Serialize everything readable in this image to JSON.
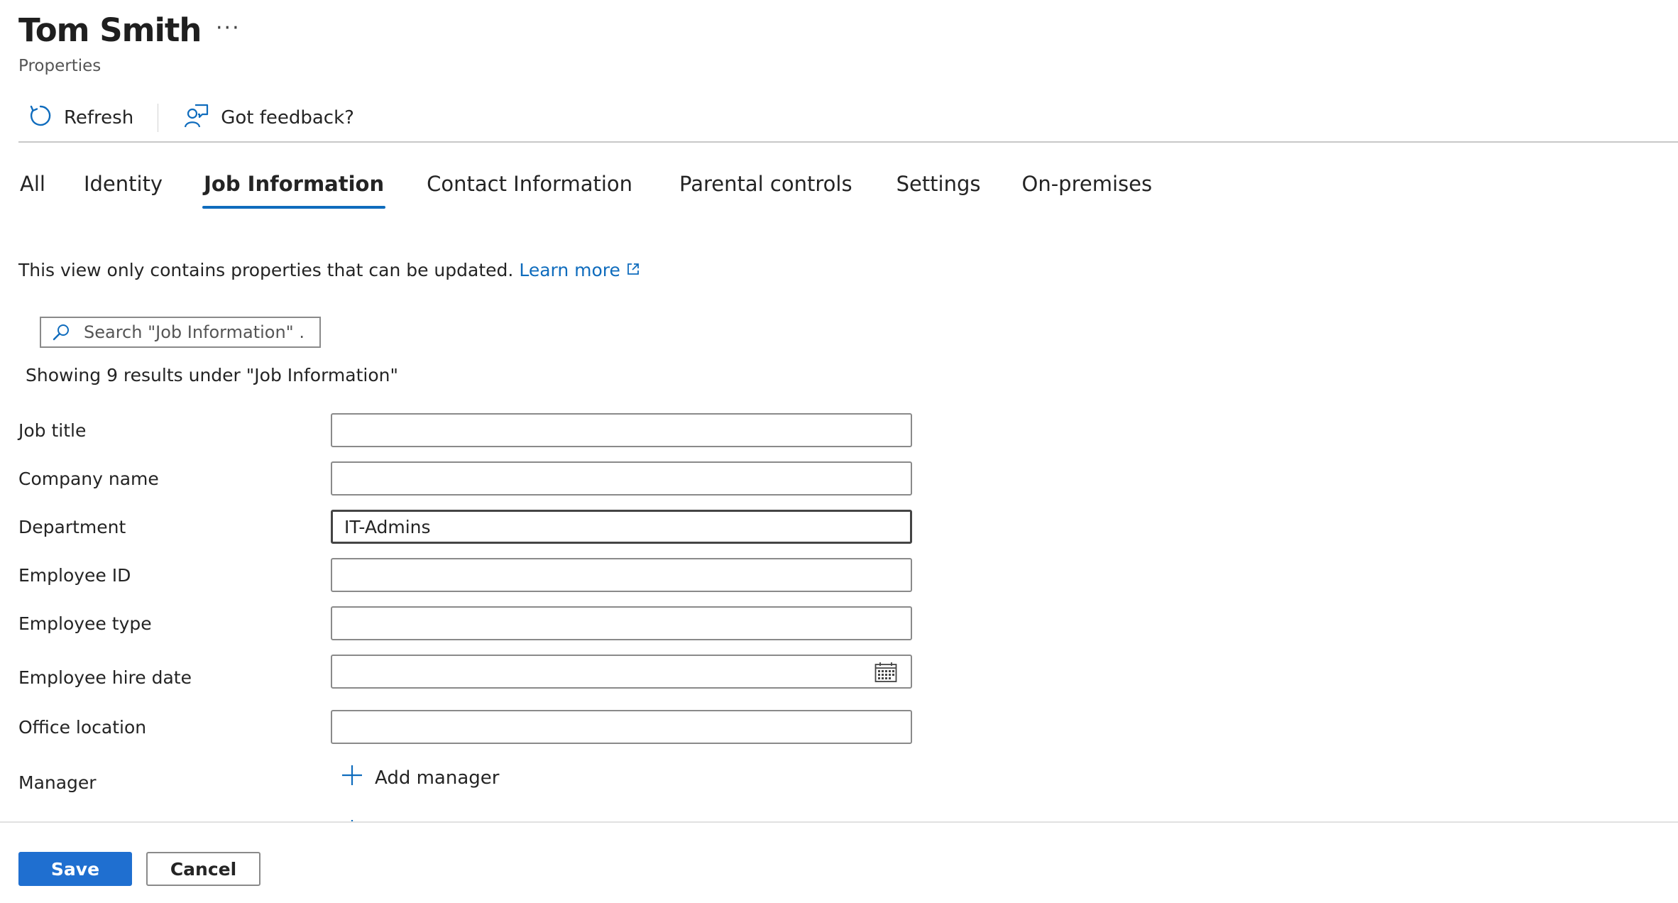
{
  "header": {
    "title": "Tom Smith",
    "more_label": "···",
    "subtitle": "Properties"
  },
  "toolbar": {
    "refresh_label": "Refresh",
    "feedback_label": "Got feedback?"
  },
  "tabs": [
    {
      "label": "All",
      "active": false
    },
    {
      "label": "Identity",
      "active": false
    },
    {
      "label": "Job Information",
      "active": true
    },
    {
      "label": "Contact Information",
      "active": false
    },
    {
      "label": "Parental controls",
      "active": false
    },
    {
      "label": "Settings",
      "active": false
    },
    {
      "label": "On-premises",
      "active": false
    }
  ],
  "info": {
    "text": "This view only contains properties that can be updated.",
    "link_label": "Learn more"
  },
  "search": {
    "placeholder": "Search \"Job Information\" ..."
  },
  "results_text": "Showing 9 results under \"Job Information\"",
  "form": {
    "job_title": {
      "label": "Job title",
      "value": ""
    },
    "company_name": {
      "label": "Company name",
      "value": ""
    },
    "department": {
      "label": "Department",
      "value": "IT-Admins"
    },
    "employee_id": {
      "label": "Employee ID",
      "value": ""
    },
    "employee_type": {
      "label": "Employee type",
      "value": ""
    },
    "employee_hire_date": {
      "label": "Employee hire date",
      "value": ""
    },
    "office_location": {
      "label": "Office location",
      "value": ""
    },
    "manager": {
      "label": "Manager",
      "add_label": "Add manager"
    }
  },
  "footer": {
    "save_label": "Save",
    "cancel_label": "Cancel"
  },
  "colors": {
    "accent": "#0f6cbd",
    "primary_button": "#1f6fd0"
  }
}
